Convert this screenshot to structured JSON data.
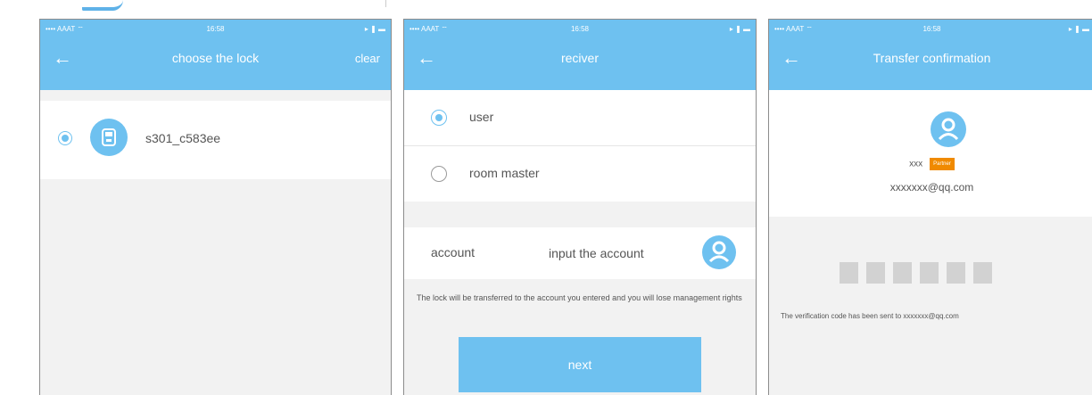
{
  "colors": {
    "accent": "#6ec1f0",
    "badge": "#f08a00"
  },
  "status": {
    "carrier": "•••• AAAT ⌔",
    "time": "16:58",
    "battery": "▸ ❚ ▬"
  },
  "screen1": {
    "title": "choose the lock",
    "clear_label": "clear",
    "lock": {
      "name": "s301_c583ee",
      "selected": true,
      "icon": "lock-icon"
    }
  },
  "screen2": {
    "title": "reciver",
    "options": [
      {
        "label": "user",
        "selected": true
      },
      {
        "label": "room master",
        "selected": false
      }
    ],
    "account_label": "account",
    "account_placeholder": "input the account",
    "hint": "The lock will be transferred to the account you entered and you will lose management rights",
    "next_label": "next"
  },
  "screen3": {
    "title": "Transfer confirmation",
    "user_name": "xxx",
    "badge": "Partner",
    "email": "xxxxxxx@qq.com",
    "code_boxes": 6,
    "sent_message": "The verification code has been sent to xxxxxxx@qq.com"
  }
}
